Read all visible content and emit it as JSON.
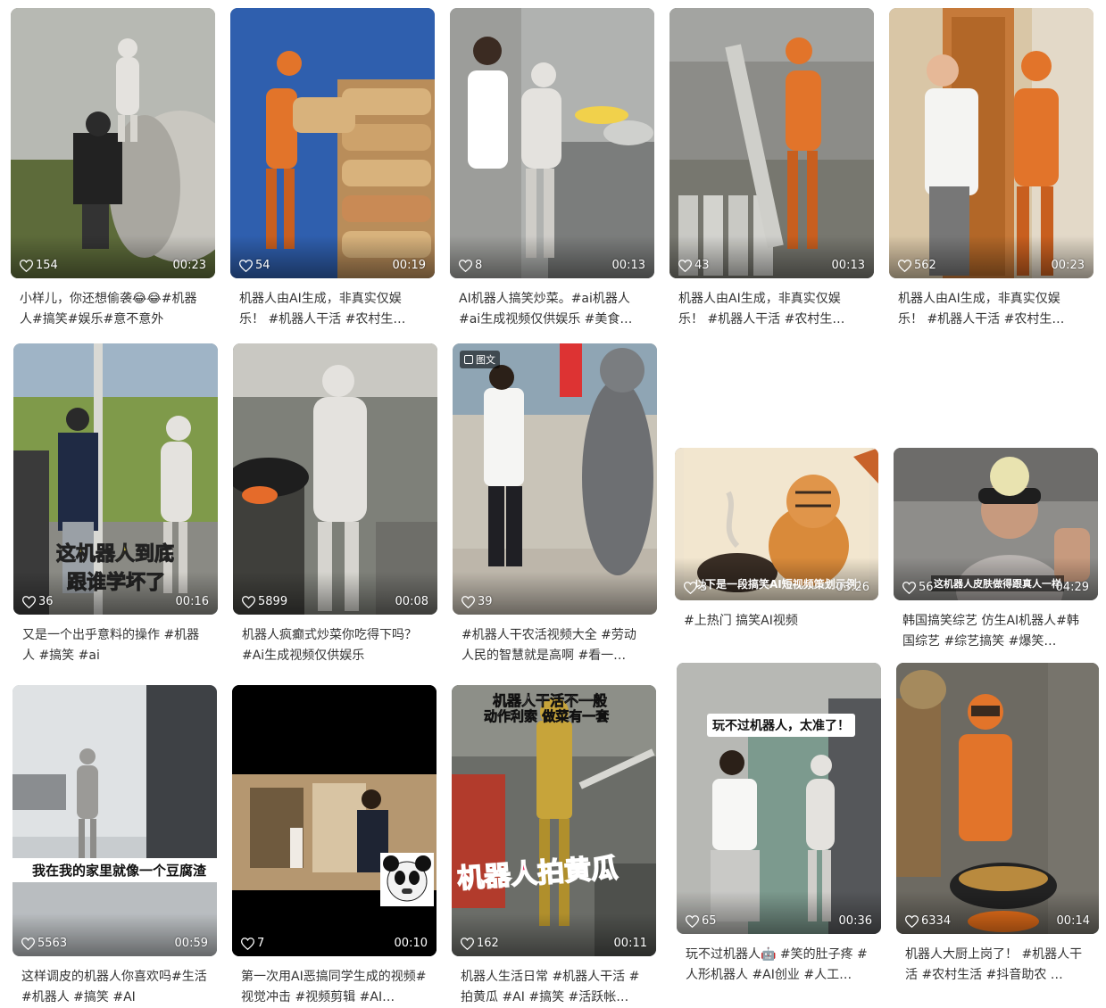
{
  "videos": [
    {
      "likes": "154",
      "duration": "00:23",
      "caption": "小样儿，你还想偷袭😂😂#机器人#搞笑#娱乐#意不意外"
    },
    {
      "likes": "54",
      "duration": "00:19",
      "caption": "机器人由AI生成，非真实仅娱乐！ #机器人干活 #农村生…"
    },
    {
      "likes": "8",
      "duration": "00:13",
      "caption": "AI机器人搞笑炒菜。#ai机器人 #ai生成视频仅供娱乐 #美食…"
    },
    {
      "likes": "43",
      "duration": "00:13",
      "caption": "机器人由AI生成，非真实仅娱乐！ #机器人干活 #农村生…"
    },
    {
      "likes": "562",
      "duration": "00:23",
      "caption": "机器人由AI生成，非真实仅娱乐！ #机器人干活 #农村生…"
    },
    {
      "likes": "36",
      "duration": "00:16",
      "caption": "又是一个出乎意料的操作 #机器人 #搞笑 #ai",
      "overlay": [
        "这机器人到底",
        "跟谁学坏了"
      ]
    },
    {
      "likes": "5899",
      "duration": "00:08",
      "caption": "机器人疯癫式炒菜你吃得下吗？ #Ai生成视频仅供娱乐"
    },
    {
      "likes": "39",
      "duration": "",
      "caption": "#机器人干农活视频大全 #劳动人民的智慧就是高啊 #看一…",
      "badge": "图文"
    },
    {
      "likes": "3",
      "duration": "03:26",
      "caption": "#上热门 搞笑AI视频",
      "overlay": [
        "以下是一段搞笑AI短视频策划示例："
      ]
    },
    {
      "likes": "56",
      "duration": "04:29",
      "caption": "韩国搞笑综艺 仿生AI机器人#韩国综艺 #综艺搞笑 #爆笑…",
      "overlay": [
        "这机器人皮肤做得跟真人一样"
      ]
    },
    {
      "likes": "5563",
      "duration": "00:59",
      "caption": "这样调皮的机器人你喜欢吗#生活 #机器人 #搞笑 #AI",
      "overlay": [
        "我在我的家里就像一个豆腐渣"
      ]
    },
    {
      "likes": "7",
      "duration": "00:10",
      "caption": "第一次用AI恶搞同学生成的视频#视觉冲击 #视频剪辑 #AI…"
    },
    {
      "likes": "162",
      "duration": "00:11",
      "caption": "机器人生活日常 #机器人干活 #拍黄瓜 #AI #搞笑 #活跃帐…",
      "overlay": [
        "机器人干活不一般",
        "动作利索 做菜有一套",
        "机器人拍黄瓜"
      ]
    },
    {
      "likes": "65",
      "duration": "00:36",
      "caption": "玩不过机器人🤖 #笑的肚子疼 #人形机器人 #AI创业 #人工…",
      "overlay": [
        "玩不过机器人，太准了！"
      ]
    },
    {
      "likes": "6334",
      "duration": "00:14",
      "caption": "机器人大厨上岗了！ #机器人干活 #农村生活 #抖音助农 …"
    }
  ],
  "icons": {
    "like": "heart-outline-icon",
    "badge": "image-text-icon"
  },
  "colors": {
    "robot_orange": "#e2742a",
    "robot_white": "#e4e2de",
    "caption_text": "#333333",
    "overlay_yellow": "#f6e04b",
    "overlay_pink": "#e8376b"
  }
}
